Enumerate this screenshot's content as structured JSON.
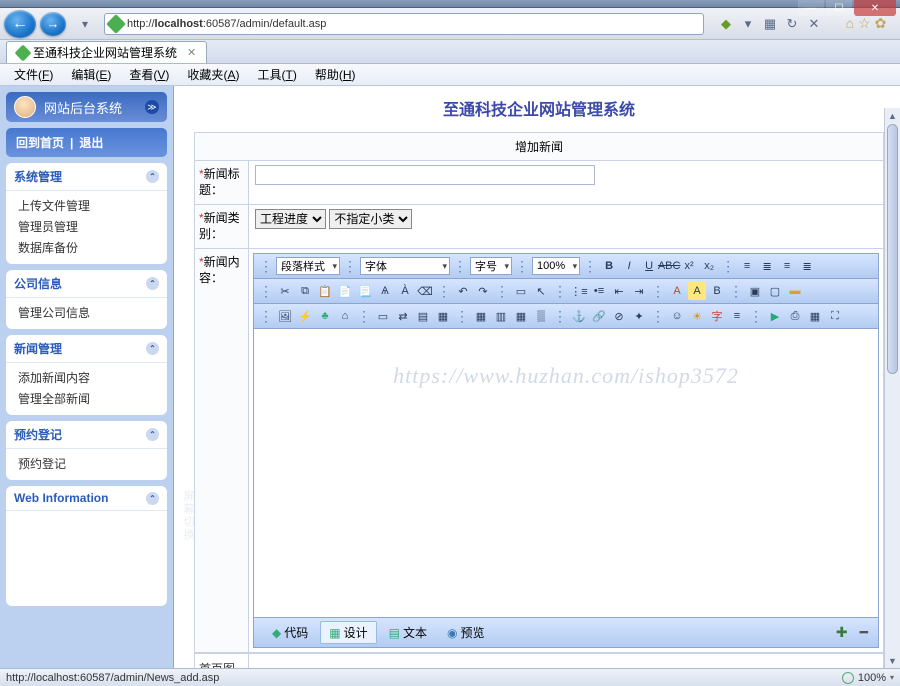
{
  "window": {
    "title_blur": ""
  },
  "browser": {
    "url_prefix": "http://",
    "url_host": "localhost",
    "url_port_path": ":60587/admin/default.asp",
    "tab_title": "至通科技企业网站管理系统",
    "menu": {
      "file": "文件",
      "file_u": "F",
      "edit": "编辑",
      "edit_u": "E",
      "view": "查看",
      "view_u": "V",
      "fav": "收藏夹",
      "fav_u": "A",
      "tools": "工具",
      "tools_u": "T",
      "help": "帮助",
      "help_u": "H"
    }
  },
  "sidebar": {
    "header": "网站后台系统",
    "nav_home": "回到首页",
    "nav_sep": " | ",
    "nav_logout": "退出",
    "panels": [
      {
        "title": "系统管理",
        "items": [
          "上传文件管理",
          "管理员管理",
          "数据库备份"
        ]
      },
      {
        "title": "公司信息",
        "items": [
          "管理公司信息"
        ]
      },
      {
        "title": "新闻管理",
        "items": [
          "添加新闻内容",
          "管理全部新闻"
        ]
      },
      {
        "title": "预约登记",
        "items": [
          "预约登记"
        ]
      }
    ],
    "web_info": "Web Information",
    "collapse_label": "屏幕切换"
  },
  "content": {
    "page_title": "至通科技企业网站管理系统",
    "panel_title": "增加新闻",
    "fields": {
      "title_label": "新闻标题：",
      "cat_label": "新闻类别：",
      "cat_value": "工程进度",
      "subcat_value": "不指定小类",
      "body_label": "新闻内容：",
      "thumb_label": "首页图"
    },
    "editor": {
      "para_style": "段落样式",
      "font": "字体",
      "size_lbl": "字号",
      "zoom": "100%",
      "tabs": {
        "code": "代码",
        "design": "设计",
        "text": "文本",
        "preview": "预览"
      }
    },
    "watermark": "https://www.huzhan.com/ishop3572"
  },
  "status": {
    "url": "http://localhost:60587/admin/News_add.asp",
    "zoom": "100%"
  }
}
